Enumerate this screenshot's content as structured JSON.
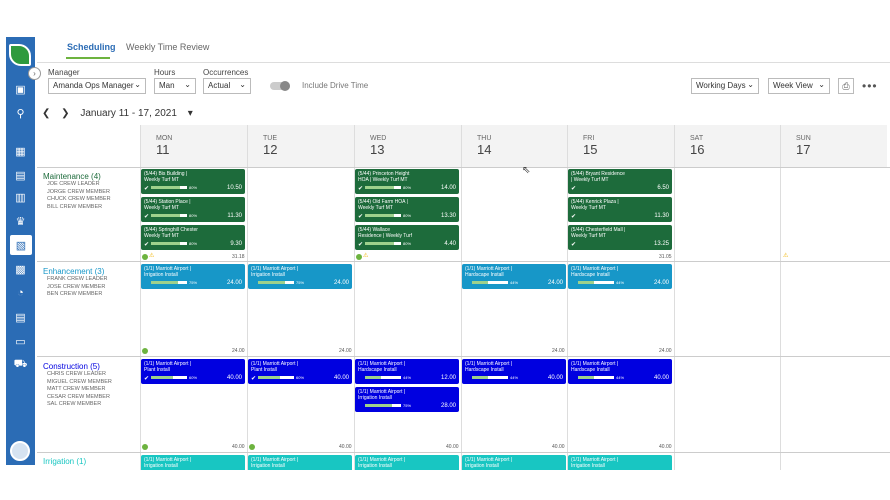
{
  "tabs": [
    {
      "label": "Scheduling",
      "active": true
    },
    {
      "label": "Weekly Time Review",
      "active": false
    }
  ],
  "filters": {
    "manager": {
      "label": "Manager",
      "value": "Amanda Ops Manager"
    },
    "hours": {
      "label": "Hours",
      "value": "Man"
    },
    "occurrences": {
      "label": "Occurrences",
      "value": "Actual"
    },
    "drive_time_label": "Include Drive Time",
    "working_days": "Working Days",
    "view": "Week View"
  },
  "date_range": "January 11 - 17, 2021",
  "days": [
    {
      "name": "MON",
      "date": "11"
    },
    {
      "name": "TUE",
      "date": "12"
    },
    {
      "name": "WED",
      "date": "13"
    },
    {
      "name": "THU",
      "date": "14"
    },
    {
      "name": "FRI",
      "date": "15"
    },
    {
      "name": "SAT",
      "date": "16"
    },
    {
      "name": "SUN",
      "date": "17"
    }
  ],
  "groups": [
    {
      "name": "Maintenance (4)",
      "color": "#1d6b3b",
      "members": [
        "JOE CREW LEADER",
        "JORGE CREW MEMBER",
        "CHUCK CREW MEMBER",
        "BILL CREW MEMBER"
      ]
    },
    {
      "name": "Enhancement (3)",
      "color": "#1797c8",
      "members": [
        "FRANK CREW LEADER",
        "JOSE CREW MEMBER",
        "BEN CREW MEMBER"
      ]
    },
    {
      "name": "Construction (5)",
      "color": "#0000e0",
      "members": [
        "CHRIS CREW LEADER",
        "MIGUEL CREW MEMBER",
        "MATT CREW MEMBER",
        "CESAR CREW MEMBER",
        "SAL CREW MEMBER"
      ]
    },
    {
      "name": "Irrigation (1)",
      "color": "#18c6c2",
      "members": []
    }
  ],
  "totals": {
    "maintenance": {
      "mon": "31.18",
      "fri": "31.05"
    },
    "enhancement": {
      "mon": "24.00",
      "tue": "24.00",
      "thu": "24.00",
      "fri": "24.00"
    },
    "construction": {
      "mon": "40.00",
      "tue": "40.00",
      "wed": "40.00",
      "thu": "40.00",
      "fri": "40.00"
    }
  },
  "cards": {
    "m_mon": [
      {
        "t1": "(5/44) Bis Building |",
        "t2": "Weekly Turf MT",
        "pct": "80%",
        "hrs": "10.50",
        "progress": 0.8
      },
      {
        "t1": "(5/44) Station Place |",
        "t2": "Weekly Turf MT",
        "pct": "80%",
        "hrs": "11.30",
        "progress": 0.8
      },
      {
        "t1": "(5/44) Springhill Chester",
        "t2": "Weekly Turf MT",
        "pct": "80%",
        "hrs": "9.30",
        "progress": 0.8
      }
    ],
    "m_wed": [
      {
        "t1": "(5/44) Princeton Height",
        "t2": "HOA | Weekly Turf MT",
        "pct": "80%",
        "hrs": "14.00",
        "progress": 0.8
      },
      {
        "t1": "(5/44) Old Farm HOA |",
        "t2": "Weekly Turf MT",
        "pct": "80%",
        "hrs": "13.30",
        "progress": 0.8
      },
      {
        "t1": "(5/44) Wallace",
        "t2": "Residence | Weekly Turf",
        "pct": "80%",
        "hrs": "4.40",
        "progress": 0.8
      }
    ],
    "m_fri": [
      {
        "t1": "(5/44) Bryant Residence",
        "t2": "| Weekly Turf MT",
        "pct": "",
        "hrs": "6.50",
        "progress": 0
      },
      {
        "t1": "(5/44) Kenrick Plaza |",
        "t2": "Weekly Turf MT",
        "pct": "",
        "hrs": "11.30",
        "progress": 0
      },
      {
        "t1": "(5/44) Chesterfield Mall |",
        "t2": "Weekly Turf MT",
        "pct": "",
        "hrs": "13.25",
        "progress": 0
      }
    ],
    "enh": {
      "t1": "(1/1) Marriott Airport |",
      "t2": "Irrigation Install",
      "pct": "75%",
      "hrs": "24.00",
      "progress": 0.75
    },
    "enh_thu": {
      "t1": "(1/1) Marriott Airport |",
      "t2": "Hardscape Install",
      "pct": "44%",
      "hrs": "24.00",
      "progress": 0.44
    },
    "con_plant": {
      "t1": "(1/1) Marriott Airport |",
      "t2": "Plant Install",
      "pct": "60%",
      "hrs": "40.00",
      "progress": 0.6
    },
    "con_wed1": {
      "t1": "(1/1) Marriott Airport |",
      "t2": "Hardscape Install",
      "pct": "44%",
      "hrs": "12.00",
      "progress": 0.44
    },
    "con_wed2": {
      "t1": "(1/1) Marriott Airport |",
      "t2": "Irrigation Install",
      "pct": "75%",
      "hrs": "28.00",
      "progress": 0.75
    },
    "con_hard": {
      "t1": "(1/1) Marriott Airport |",
      "t2": "Hardscape Install",
      "pct": "44%",
      "hrs": "40.00",
      "progress": 0.44
    },
    "irr": {
      "t1": "(1/1) Marriott Airport |",
      "t2": "Irrigation Install"
    }
  },
  "colors": {
    "accent": "#2b6cb5",
    "maintenance": "#1d6b3b",
    "enhancement": "#1797c8",
    "construction": "#0000e0",
    "irrigation": "#18c6c2"
  }
}
